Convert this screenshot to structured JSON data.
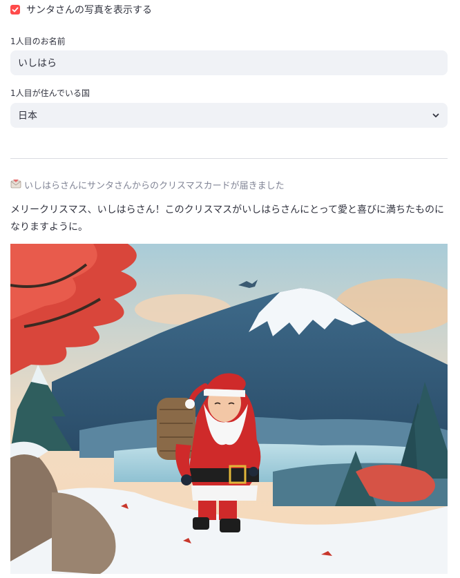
{
  "checkbox": {
    "label": "サンタさんの写真を表示する",
    "checked": true
  },
  "name_field": {
    "label": "1人目のお名前",
    "value": "いしはら"
  },
  "country_field": {
    "label": "1人目が住んでいる国",
    "value": "日本"
  },
  "notice": {
    "icon": "envelope-icon",
    "text": "いしはらさんにサンタさんからのクリスマスカードが届きました"
  },
  "message": {
    "text": "メリークリスマス、いしはらさん！このクリスマスがいしはらさんにとって愛と喜びに満ちたものになりますように。"
  },
  "image": {
    "subject": "santa-claus-mount-fuji-illustration"
  },
  "colors": {
    "accent": "#ff4b4b",
    "input_bg": "#f0f2f6",
    "text": "#31333f",
    "muted": "#808495"
  }
}
